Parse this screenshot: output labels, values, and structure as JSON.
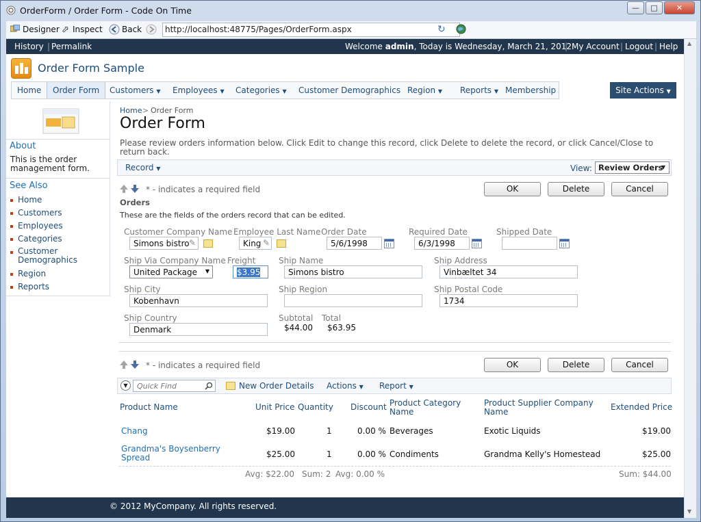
{
  "window": {
    "title": "OrderForm / Order Form - Code On Time"
  },
  "browser": {
    "designer": "Designer",
    "inspect": "Inspect",
    "back": "Back",
    "url": "http://localhost:48775/Pages/OrderForm.aspx"
  },
  "topbar": {
    "history": "History",
    "permalink": "Permalink",
    "welcome": "Welcome",
    "user": "admin",
    "today": ", Today is Wednesday, March 21, 2012",
    "my_account": "My Account",
    "logout": "Logout",
    "help": "Help"
  },
  "site": {
    "title": "Order Form Sample"
  },
  "nav": {
    "items": [
      "Home",
      "Order Form",
      "Customers",
      "Employees",
      "Categories",
      "Customer Demographics",
      "Region",
      "Reports",
      "Membership"
    ],
    "site_actions": "Site Actions"
  },
  "sidebar": {
    "about_title": "About",
    "about_text": "This is the order management form.",
    "see_also_title": "See Also",
    "links": [
      "Home",
      "Customers",
      "Employees",
      "Categories",
      "Customer Demographics",
      "Region",
      "Reports"
    ]
  },
  "breadcrumb": {
    "home": "Home",
    "sep": ">",
    "current": "Order Form"
  },
  "page": {
    "title": "Order Form",
    "description": "Please review orders information below. Click Edit to change this record, click Delete to delete the record, or click Cancel/Close to return back."
  },
  "commands": {
    "record": "Record",
    "view_label": "View:",
    "view_value": "Review Orders"
  },
  "form": {
    "required_note": "* - indicates a required field",
    "ok": "OK",
    "delete": "Delete",
    "cancel": "Cancel",
    "section_title": "Orders",
    "section_desc": "These are the fields of the orders record that can be edited.",
    "labels": {
      "customer": "Customer Company Name",
      "employee": "Employee Last Name",
      "order_date": "Order Date",
      "required_date": "Required Date",
      "shipped_date": "Shipped Date",
      "ship_via": "Ship Via Company Name",
      "freight": "Freight",
      "ship_name": "Ship Name",
      "ship_address": "Ship Address",
      "ship_city": "Ship City",
      "ship_region": "Ship Region",
      "ship_postal": "Ship Postal Code",
      "ship_country": "Ship Country",
      "subtotal": "Subtotal",
      "total": "Total"
    },
    "values": {
      "customer": "Simons bistro",
      "employee": "King",
      "order_date": "5/6/1998",
      "required_date": "6/3/1998",
      "shipped_date": "",
      "ship_via": "United Package",
      "freight": "$3.95",
      "ship_name": "Simons bistro",
      "ship_address": "Vinbæltet 34",
      "ship_city": "Kobenhavn",
      "ship_region": "",
      "ship_postal": "1734",
      "ship_country": "Denmark",
      "subtotal": "$44.00",
      "total": "$63.95"
    }
  },
  "details": {
    "quick_find": "Quick Find",
    "new": "New Order Details",
    "actions": "Actions",
    "report": "Report",
    "columns": [
      "Product Name",
      "Unit Price",
      "Quantity",
      "Discount",
      "Product Category Name",
      "Product Supplier Company Name",
      "Extended Price"
    ],
    "rows": [
      {
        "product": "Chang",
        "unit_price": "$19.00",
        "quantity": "1",
        "discount": "0.00 %",
        "category": "Beverages",
        "supplier": "Exotic Liquids",
        "extended": "$19.00"
      },
      {
        "product": "Grandma's Boysenberry Spread",
        "unit_price": "$25.00",
        "quantity": "1",
        "discount": "0.00 %",
        "category": "Condiments",
        "supplier": "Grandma Kelly's Homestead",
        "extended": "$25.00"
      }
    ],
    "summary": {
      "unit_price": "Avg: $22.00",
      "quantity": "Sum: 2",
      "discount": "Avg: 0.00 %",
      "extended": "Sum: $44.00"
    }
  },
  "footer": {
    "text": "© 2012 MyCompany. All rights reserved."
  }
}
